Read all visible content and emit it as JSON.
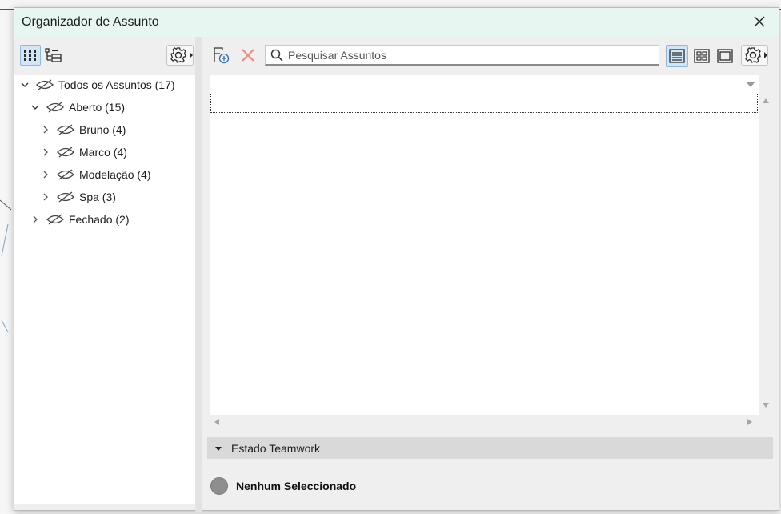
{
  "window": {
    "title": "Organizador de Assunto"
  },
  "left_toolbar": {
    "buttons": [
      "grid-view-icon",
      "tree-view-icon",
      "settings-menu-icon"
    ]
  },
  "tree": {
    "items": [
      {
        "label": "Todos os Assuntos (17)",
        "expanded": true,
        "level": 0
      },
      {
        "label": "Aberto (15)",
        "expanded": true,
        "level": 1
      },
      {
        "label": "Bruno (4)",
        "expanded": false,
        "level": 2
      },
      {
        "label": "Marco (4)",
        "expanded": false,
        "level": 2
      },
      {
        "label": "Modelação (4)",
        "expanded": false,
        "level": 2
      },
      {
        "label": "Spa (3)",
        "expanded": false,
        "level": 2
      },
      {
        "label": "Fechado (2)",
        "expanded": false,
        "level": 1
      }
    ]
  },
  "right_toolbar": {
    "search": {
      "placeholder": "Pesquisar Assuntos",
      "value": ""
    },
    "active_view": "list"
  },
  "section": {
    "label": "Estado Teamwork"
  },
  "status": {
    "text": "Nenhum Seleccionado"
  },
  "colors": {
    "title_bar": "#e8f6f2",
    "active_button": "#d3e6f7",
    "delete_icon": "#f08a7a",
    "status_dot": "#8e8e8e"
  }
}
